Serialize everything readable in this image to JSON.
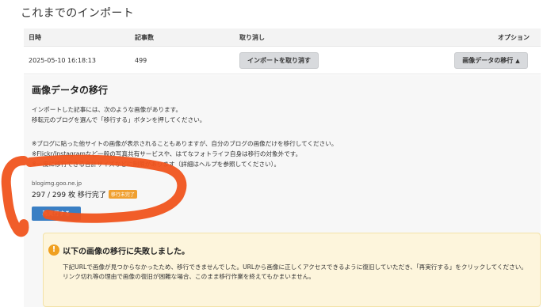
{
  "page": {
    "title": "これまでのインポート"
  },
  "table": {
    "headers": {
      "date": "日時",
      "count": "記事数",
      "cancel": "取り消し",
      "option": "オプション"
    },
    "row": {
      "date": "2025-05-10 16:18:13",
      "count": "499",
      "cancel_button": "インポートを取り消す",
      "migrate_button": "画像データの移行"
    }
  },
  "panel": {
    "title": "画像データの移行",
    "intro": [
      "インポートした記事には、次のような画像があります。",
      "移転元のブログを選んで「移行する」ボタンを押してください。"
    ],
    "notes": [
      "※ブログに貼った他サイトの画像が表示されることもありますが、自分のブログの画像だけを移行してください。",
      "※Flickr/Instagramなど一般の写真共有サービスや、はてなフォトライフ自身は移行の対象外です。",
      "※一度に移行できる合計サイズなどに制限があります（詳細はヘルプを参照してください）。"
    ],
    "source": "blogimg.goo.ne.jp",
    "progress": "297 / 299 枚 移行完了",
    "badge": "移行未完了",
    "rerun_button": "再実行する"
  },
  "alert": {
    "icon": "!",
    "title": "以下の画像の移行に失敗しました。",
    "body": [
      "下記URLで画像が見つからなかったため、移行できませんでした。URLから画像に正しくアクセスできるように復旧していただき、「再実行する」をクリックしてください。",
      "リンク切れ等の理由で画像の復旧が困難な場合、このまま移行作業を終えてもかまいません。"
    ]
  },
  "annotation_color": "#f0541e"
}
